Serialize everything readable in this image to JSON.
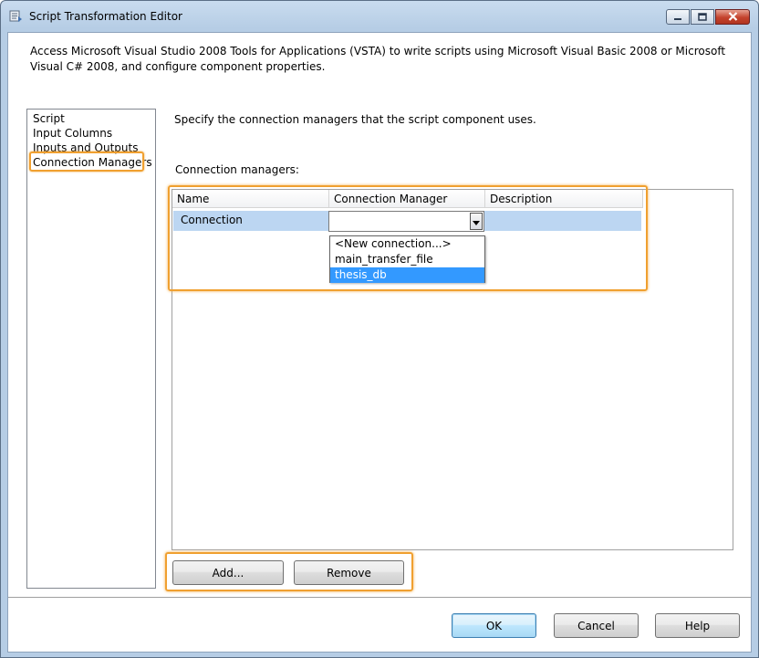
{
  "window": {
    "title": "Script Transformation Editor",
    "description": "Access Microsoft Visual Studio 2008 Tools for Applications (VSTA) to write scripts using Microsoft Visual Basic 2008 or Microsoft Visual C# 2008, and configure component properties."
  },
  "sidebar": {
    "items": [
      {
        "label": "Script"
      },
      {
        "label": "Input Columns"
      },
      {
        "label": "Inputs and Outputs"
      },
      {
        "label": "Connection Managers",
        "selected": true
      }
    ]
  },
  "main": {
    "hint": "Specify the connection managers that the script component uses.",
    "grid_label": "Connection managers:",
    "columns": [
      "Name",
      "Connection Manager",
      "Description"
    ],
    "rows": [
      {
        "name": "Connection",
        "connection_manager": "",
        "description": ""
      }
    ],
    "dropdown_options": [
      "<New connection...>",
      "main_transfer_file",
      "thesis_db"
    ],
    "dropdown_selected": "thesis_db"
  },
  "buttons": {
    "add": "Add...",
    "remove": "Remove",
    "ok": "OK",
    "cancel": "Cancel",
    "help": "Help"
  },
  "colors": {
    "highlight": "#f0a030",
    "selection": "#3399ff",
    "row_selection": "#bcd6f2"
  }
}
